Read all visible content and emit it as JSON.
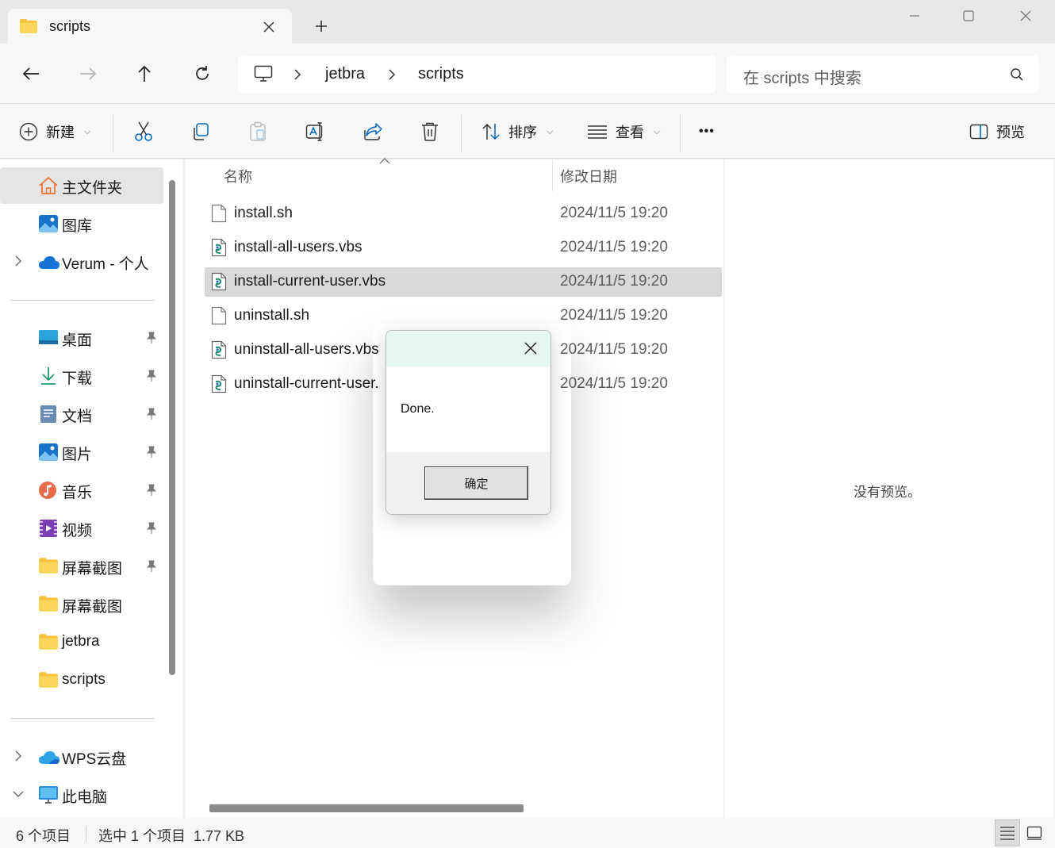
{
  "window": {
    "tab_title": "scripts",
    "icons": {
      "tab": "folder-icon",
      "new_tab": "plus-icon",
      "minimize": "minimize-icon",
      "maximize": "maximize-icon",
      "close": "close-icon"
    }
  },
  "address": {
    "crumbs": [
      "jetbra",
      "scripts"
    ],
    "search_placeholder": "在 scripts 中搜索"
  },
  "toolbar": {
    "new_label": "新建",
    "sort_label": "排序",
    "view_label": "查看",
    "more_label": "•••",
    "preview_label": "预览"
  },
  "sidebar": {
    "home": "主文件夹",
    "gallery": "图库",
    "cloud": "Verum - 个人",
    "pinned": [
      "桌面",
      "下载",
      "文档",
      "图片",
      "音乐",
      "视频",
      "屏幕截图"
    ],
    "folders": [
      "屏幕截图",
      "jetbra",
      "scripts"
    ],
    "wps": "WPS云盘",
    "pc": "此电脑"
  },
  "filelist": {
    "col_name": "名称",
    "col_date": "修改日期",
    "files": [
      {
        "name": "install.sh",
        "date": "2024/11/5 19:20",
        "type": "sh"
      },
      {
        "name": "install-all-users.vbs",
        "date": "2024/11/5 19:20",
        "type": "vbs"
      },
      {
        "name": "install-current-user.vbs",
        "date": "2024/11/5 19:20",
        "type": "vbs",
        "selected": true
      },
      {
        "name": "uninstall.sh",
        "date": "2024/11/5 19:20",
        "type": "sh"
      },
      {
        "name": "uninstall-all-users.vbs",
        "date": "2024/11/5 19:20",
        "type": "vbs"
      },
      {
        "name": "uninstall-current-user.",
        "date": "2024/11/5 19:20",
        "type": "vbs"
      }
    ]
  },
  "preview": {
    "empty_text": "没有预览。"
  },
  "status": {
    "count": "6 个项目",
    "selection": "选中 1 个项目  1.77 KB"
  },
  "dialog": {
    "message": "Done.",
    "ok_label": "确定"
  },
  "colors": {
    "selected_row": "#d9d9d9",
    "dialog_title": "#e5f6f3",
    "folder": "#f5c542",
    "accent": "#0067c0"
  }
}
